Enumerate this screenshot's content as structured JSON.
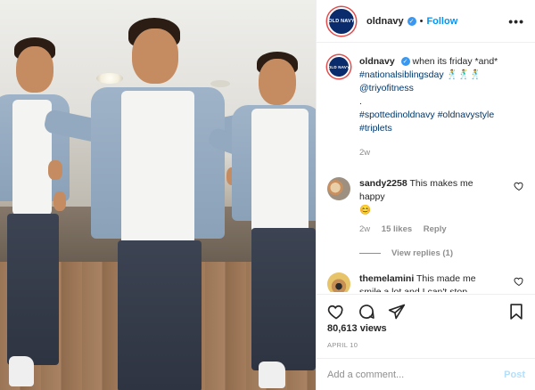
{
  "header": {
    "logo_text": "OLD NAVY",
    "username": "oldnavy",
    "separator": "•",
    "follow_label": "Follow",
    "more_label": "•••"
  },
  "caption": {
    "username": "oldnavy",
    "text": "when its friday *and*",
    "hashtag_1": "#nationalsiblingsday",
    "emoji": "🕺🕺🕺",
    "mention": "@triyofitness",
    "dot": ".",
    "hashtags_2": "#spottedinoldnavy #oldnavystyle",
    "hashtag_3": "#triplets",
    "age": "2w"
  },
  "comments": [
    {
      "username": "sandy2258",
      "text": "This makes me happy",
      "emoji": "😊",
      "age": "2w",
      "likes": "15 likes",
      "reply_label": "Reply",
      "view_replies": "View replies (1)"
    },
    {
      "username": "themelamini",
      "text": "This made me smile a lot and I can't stop watching it! What a blessing they are!"
    }
  ],
  "stats": {
    "views": "80,613 views",
    "date": "APRIL 10"
  },
  "composer": {
    "placeholder": "Add a comment...",
    "post_label": "Post"
  },
  "colors": {
    "link_blue": "#0095f6",
    "hashtag_blue": "#00376b",
    "brand_navy": "#0b2c6c",
    "muted": "#8e8e8e"
  },
  "icons": [
    "verified-badge-icon",
    "heart-icon",
    "comment-icon",
    "share-icon",
    "bookmark-icon",
    "more-icon"
  ]
}
